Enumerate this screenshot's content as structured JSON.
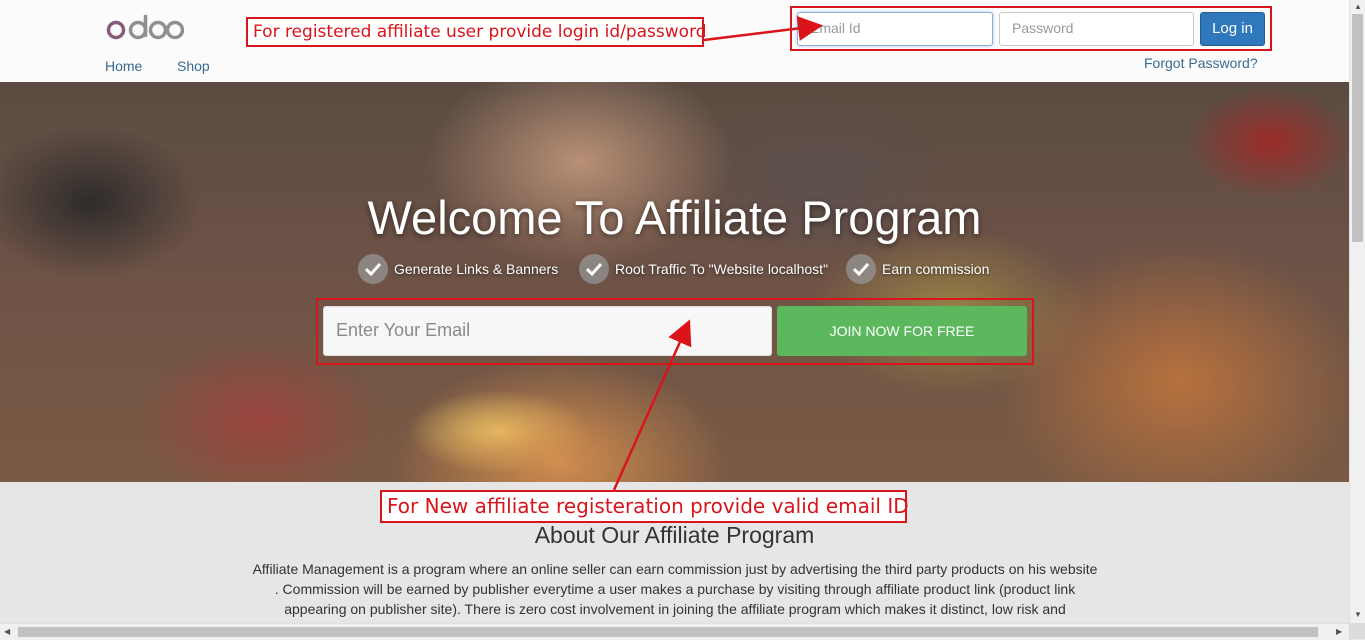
{
  "header": {
    "logo_text": "odoo",
    "nav": [
      {
        "label": "Home"
      },
      {
        "label": "Shop"
      }
    ],
    "login": {
      "email_placeholder": "Email Id",
      "password_placeholder": "Password",
      "login_label": "Log in",
      "forgot_label": "Forgot Password?"
    }
  },
  "annotations": {
    "top": "For registered affiliate user provide login id/password",
    "bottom": "For New affiliate registeration provide valid email ID"
  },
  "hero": {
    "title": "Welcome To Affiliate Program",
    "features": [
      {
        "label": "Generate Links & Banners",
        "icon": "check-icon"
      },
      {
        "label": "Root Traffic To \"Website localhost\"",
        "icon": "check-icon"
      },
      {
        "label": "Earn commission",
        "icon": "check-icon"
      }
    ],
    "email_placeholder": "Enter Your Email",
    "join_label": "JOIN NOW FOR FREE"
  },
  "about": {
    "title": "About Our Affiliate Program",
    "text": "Affiliate Management is a program where an online seller can earn commission just by advertising the third party products on his website . Commission will be earned by publisher everytime a user makes a purchase by visiting through affiliate product link (product link appearing on publisher site). There is zero cost involvement in joining the affiliate program which makes it distinct, low risk and"
  },
  "colors": {
    "annotation_red": "#d9141b",
    "login_blue": "#2f78bc",
    "join_green": "#5cb85c",
    "logo_purple": "#875a7b",
    "logo_grey": "#8f8f8f"
  }
}
